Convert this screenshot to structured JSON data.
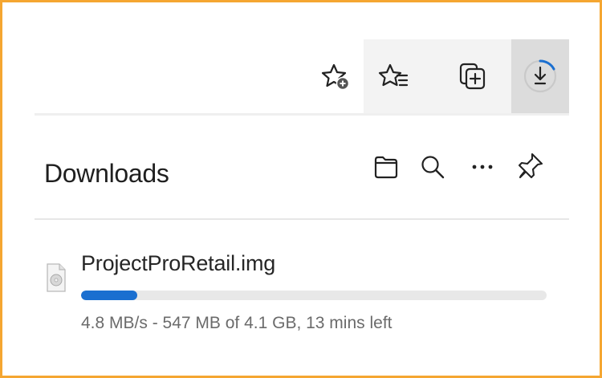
{
  "toolbar": {
    "buttons": [
      {
        "icon": "add-favorite-icon"
      },
      {
        "icon": "favorites-icon"
      },
      {
        "icon": "collections-icon"
      },
      {
        "icon": "downloads-icon",
        "active": true
      }
    ]
  },
  "downloads": {
    "title": "Downloads",
    "actions": [
      {
        "icon": "open-folder-icon"
      },
      {
        "icon": "search-icon"
      },
      {
        "icon": "more-options-icon"
      },
      {
        "icon": "pin-icon"
      }
    ],
    "items": [
      {
        "file_name": "ProjectProRetail.img",
        "progress_fraction": 0.12,
        "status": "4.8 MB/s - 547 MB of 4.1 GB, 13 mins left",
        "icon": "disc-image-file-icon"
      }
    ]
  },
  "colors": {
    "accent": "#1a6fd0",
    "frame_border": "#f5a631",
    "toolbar_bg": "#f3f3f3",
    "active_button_bg": "#dcdcdc"
  }
}
